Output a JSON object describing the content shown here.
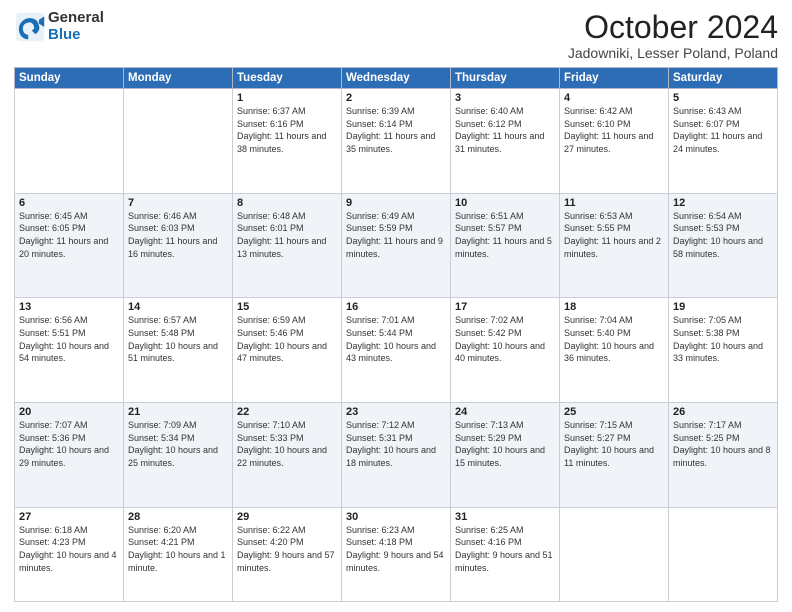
{
  "header": {
    "logo_general": "General",
    "logo_blue": "Blue",
    "month_title": "October 2024",
    "location": "Jadowniki, Lesser Poland, Poland"
  },
  "weekdays": [
    "Sunday",
    "Monday",
    "Tuesday",
    "Wednesday",
    "Thursday",
    "Friday",
    "Saturday"
  ],
  "weeks": [
    [
      {
        "day": "",
        "sunrise": "",
        "sunset": "",
        "daylight": ""
      },
      {
        "day": "",
        "sunrise": "",
        "sunset": "",
        "daylight": ""
      },
      {
        "day": "1",
        "sunrise": "Sunrise: 6:37 AM",
        "sunset": "Sunset: 6:16 PM",
        "daylight": "Daylight: 11 hours and 38 minutes."
      },
      {
        "day": "2",
        "sunrise": "Sunrise: 6:39 AM",
        "sunset": "Sunset: 6:14 PM",
        "daylight": "Daylight: 11 hours and 35 minutes."
      },
      {
        "day": "3",
        "sunrise": "Sunrise: 6:40 AM",
        "sunset": "Sunset: 6:12 PM",
        "daylight": "Daylight: 11 hours and 31 minutes."
      },
      {
        "day": "4",
        "sunrise": "Sunrise: 6:42 AM",
        "sunset": "Sunset: 6:10 PM",
        "daylight": "Daylight: 11 hours and 27 minutes."
      },
      {
        "day": "5",
        "sunrise": "Sunrise: 6:43 AM",
        "sunset": "Sunset: 6:07 PM",
        "daylight": "Daylight: 11 hours and 24 minutes."
      }
    ],
    [
      {
        "day": "6",
        "sunrise": "Sunrise: 6:45 AM",
        "sunset": "Sunset: 6:05 PM",
        "daylight": "Daylight: 11 hours and 20 minutes."
      },
      {
        "day": "7",
        "sunrise": "Sunrise: 6:46 AM",
        "sunset": "Sunset: 6:03 PM",
        "daylight": "Daylight: 11 hours and 16 minutes."
      },
      {
        "day": "8",
        "sunrise": "Sunrise: 6:48 AM",
        "sunset": "Sunset: 6:01 PM",
        "daylight": "Daylight: 11 hours and 13 minutes."
      },
      {
        "day": "9",
        "sunrise": "Sunrise: 6:49 AM",
        "sunset": "Sunset: 5:59 PM",
        "daylight": "Daylight: 11 hours and 9 minutes."
      },
      {
        "day": "10",
        "sunrise": "Sunrise: 6:51 AM",
        "sunset": "Sunset: 5:57 PM",
        "daylight": "Daylight: 11 hours and 5 minutes."
      },
      {
        "day": "11",
        "sunrise": "Sunrise: 6:53 AM",
        "sunset": "Sunset: 5:55 PM",
        "daylight": "Daylight: 11 hours and 2 minutes."
      },
      {
        "day": "12",
        "sunrise": "Sunrise: 6:54 AM",
        "sunset": "Sunset: 5:53 PM",
        "daylight": "Daylight: 10 hours and 58 minutes."
      }
    ],
    [
      {
        "day": "13",
        "sunrise": "Sunrise: 6:56 AM",
        "sunset": "Sunset: 5:51 PM",
        "daylight": "Daylight: 10 hours and 54 minutes."
      },
      {
        "day": "14",
        "sunrise": "Sunrise: 6:57 AM",
        "sunset": "Sunset: 5:48 PM",
        "daylight": "Daylight: 10 hours and 51 minutes."
      },
      {
        "day": "15",
        "sunrise": "Sunrise: 6:59 AM",
        "sunset": "Sunset: 5:46 PM",
        "daylight": "Daylight: 10 hours and 47 minutes."
      },
      {
        "day": "16",
        "sunrise": "Sunrise: 7:01 AM",
        "sunset": "Sunset: 5:44 PM",
        "daylight": "Daylight: 10 hours and 43 minutes."
      },
      {
        "day": "17",
        "sunrise": "Sunrise: 7:02 AM",
        "sunset": "Sunset: 5:42 PM",
        "daylight": "Daylight: 10 hours and 40 minutes."
      },
      {
        "day": "18",
        "sunrise": "Sunrise: 7:04 AM",
        "sunset": "Sunset: 5:40 PM",
        "daylight": "Daylight: 10 hours and 36 minutes."
      },
      {
        "day": "19",
        "sunrise": "Sunrise: 7:05 AM",
        "sunset": "Sunset: 5:38 PM",
        "daylight": "Daylight: 10 hours and 33 minutes."
      }
    ],
    [
      {
        "day": "20",
        "sunrise": "Sunrise: 7:07 AM",
        "sunset": "Sunset: 5:36 PM",
        "daylight": "Daylight: 10 hours and 29 minutes."
      },
      {
        "day": "21",
        "sunrise": "Sunrise: 7:09 AM",
        "sunset": "Sunset: 5:34 PM",
        "daylight": "Daylight: 10 hours and 25 minutes."
      },
      {
        "day": "22",
        "sunrise": "Sunrise: 7:10 AM",
        "sunset": "Sunset: 5:33 PM",
        "daylight": "Daylight: 10 hours and 22 minutes."
      },
      {
        "day": "23",
        "sunrise": "Sunrise: 7:12 AM",
        "sunset": "Sunset: 5:31 PM",
        "daylight": "Daylight: 10 hours and 18 minutes."
      },
      {
        "day": "24",
        "sunrise": "Sunrise: 7:13 AM",
        "sunset": "Sunset: 5:29 PM",
        "daylight": "Daylight: 10 hours and 15 minutes."
      },
      {
        "day": "25",
        "sunrise": "Sunrise: 7:15 AM",
        "sunset": "Sunset: 5:27 PM",
        "daylight": "Daylight: 10 hours and 11 minutes."
      },
      {
        "day": "26",
        "sunrise": "Sunrise: 7:17 AM",
        "sunset": "Sunset: 5:25 PM",
        "daylight": "Daylight: 10 hours and 8 minutes."
      }
    ],
    [
      {
        "day": "27",
        "sunrise": "Sunrise: 6:18 AM",
        "sunset": "Sunset: 4:23 PM",
        "daylight": "Daylight: 10 hours and 4 minutes."
      },
      {
        "day": "28",
        "sunrise": "Sunrise: 6:20 AM",
        "sunset": "Sunset: 4:21 PM",
        "daylight": "Daylight: 10 hours and 1 minute."
      },
      {
        "day": "29",
        "sunrise": "Sunrise: 6:22 AM",
        "sunset": "Sunset: 4:20 PM",
        "daylight": "Daylight: 9 hours and 57 minutes."
      },
      {
        "day": "30",
        "sunrise": "Sunrise: 6:23 AM",
        "sunset": "Sunset: 4:18 PM",
        "daylight": "Daylight: 9 hours and 54 minutes."
      },
      {
        "day": "31",
        "sunrise": "Sunrise: 6:25 AM",
        "sunset": "Sunset: 4:16 PM",
        "daylight": "Daylight: 9 hours and 51 minutes."
      },
      {
        "day": "",
        "sunrise": "",
        "sunset": "",
        "daylight": ""
      },
      {
        "day": "",
        "sunrise": "",
        "sunset": "",
        "daylight": ""
      }
    ]
  ]
}
